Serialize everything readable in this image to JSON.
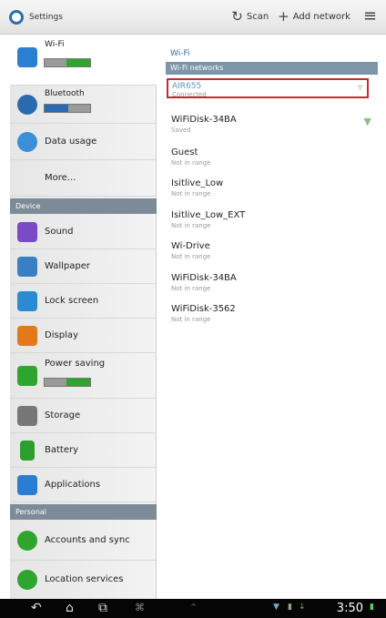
{
  "actionbar": {
    "title": "Settings",
    "scan_label": "Scan",
    "add_network_label": "Add network"
  },
  "sidebar": {
    "items": [
      {
        "label": "Wi-Fi",
        "icon": "wifi-icon"
      },
      {
        "label": "Bluetooth",
        "icon": "bluetooth-icon"
      },
      {
        "label": "Data usage",
        "icon": "data-usage-icon"
      },
      {
        "label": "More..."
      },
      {
        "label": "Sound",
        "icon": "sound-icon"
      },
      {
        "label": "Wallpaper",
        "icon": "wallpaper-icon"
      },
      {
        "label": "Lock screen",
        "icon": "lock-icon"
      },
      {
        "label": "Display",
        "icon": "display-icon"
      },
      {
        "label": "Power saving",
        "icon": "power-saving-icon"
      },
      {
        "label": "Storage",
        "icon": "storage-icon"
      },
      {
        "label": "Battery",
        "icon": "battery-icon"
      },
      {
        "label": "Applications",
        "icon": "applications-icon"
      },
      {
        "label": "Accounts and sync",
        "icon": "accounts-icon"
      },
      {
        "label": "Location services",
        "icon": "location-icon"
      }
    ],
    "sections": {
      "device": "Device",
      "personal": "Personal"
    }
  },
  "main": {
    "title": "Wi-Fi",
    "networks_header": "Wi-Fi networks",
    "networks": [
      {
        "name": "AIR655",
        "status": "Connected"
      },
      {
        "name": "WiFiDisk-34BA",
        "status": "Saved"
      },
      {
        "name": "Guest",
        "status": "Not in range"
      },
      {
        "name": "Isitlive_Low",
        "status": "Not in range"
      },
      {
        "name": "Isitlive_Low_EXT",
        "status": "Not in range"
      },
      {
        "name": "Wi-Drive",
        "status": "Not in range"
      },
      {
        "name": "WiFiDisk-34BA",
        "status": "Not in range"
      },
      {
        "name": "WiFiDisk-3562",
        "status": "Not in range"
      }
    ]
  },
  "statusbar": {
    "time": "3:50"
  },
  "colors": {
    "accent_blue": "#2f6d9c",
    "header_bar": "#7e95a8",
    "section_bar": "#7d8b98",
    "highlight_red": "#c42b2b",
    "toggle_on": "#2fa52f"
  }
}
